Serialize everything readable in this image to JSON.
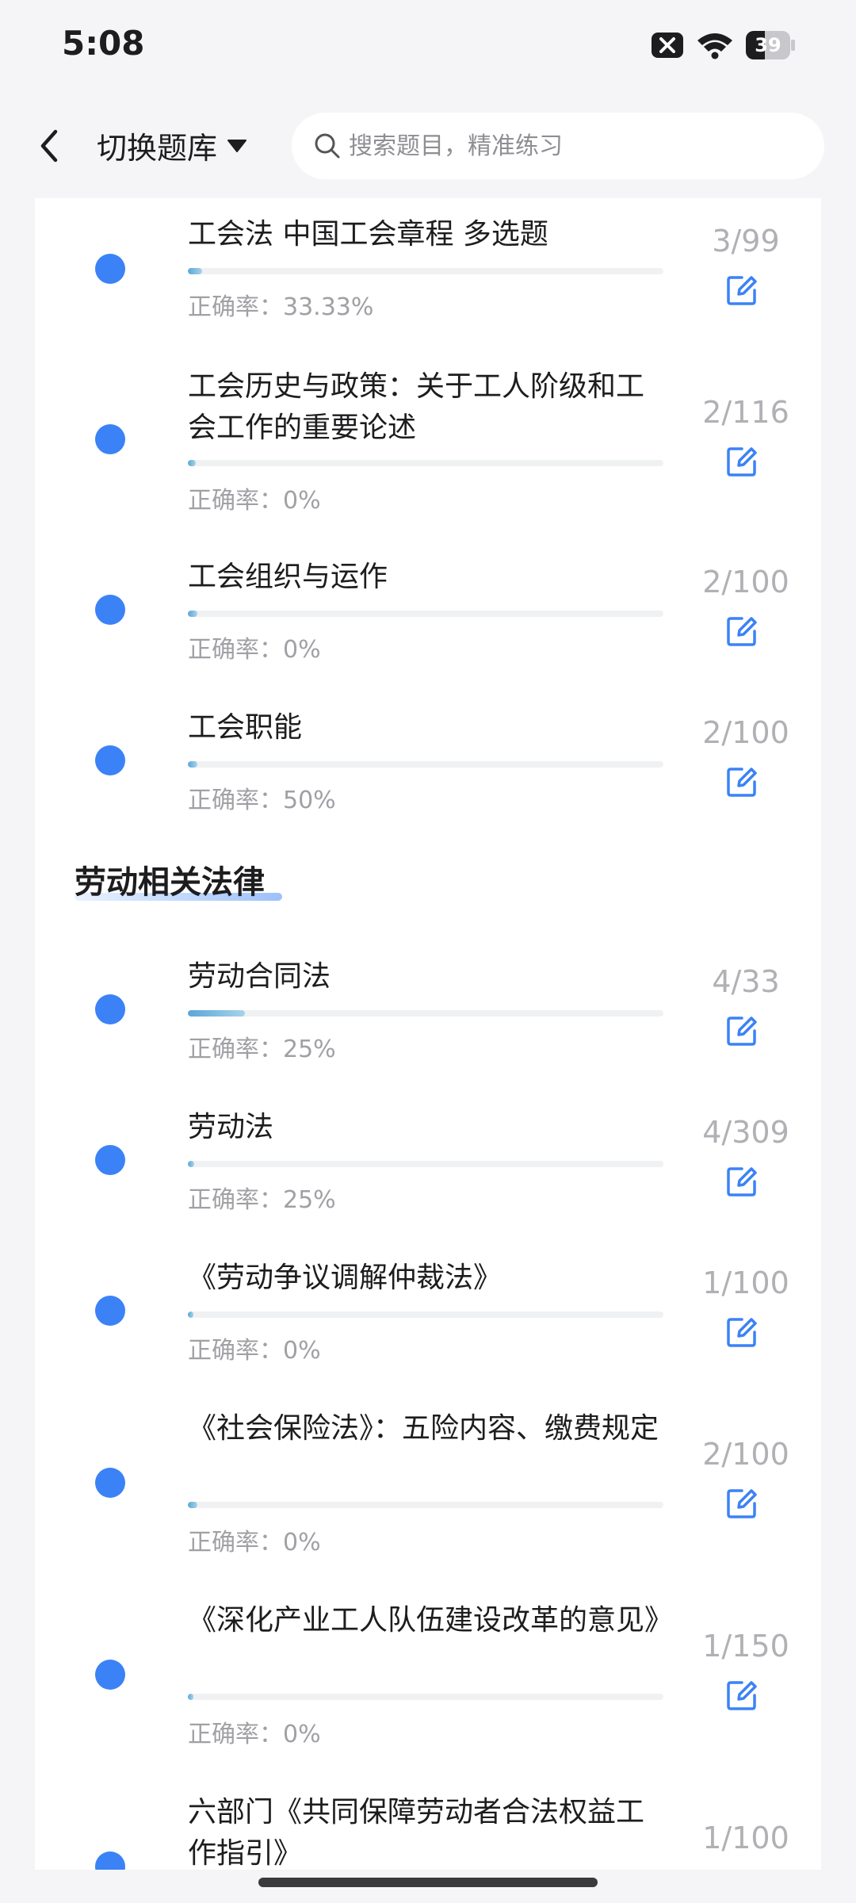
{
  "status_bar": {
    "time": "5:08",
    "battery_level": "39"
  },
  "header": {
    "bank_switch_label": "切换题库",
    "search_placeholder": "搜索题目，精准练习"
  },
  "colors": {
    "accent": "#3b82f6",
    "muted_text": "#a0a0a5",
    "count_text": "#b0b0b5"
  },
  "items_top": [
    {
      "title": "工会法 中国工会章程 多选题",
      "accuracy": "正确率：33.33%",
      "count": "3/99",
      "progress": 0.03
    },
    {
      "title": "工会历史与政策：关于工人阶级和工会工作的重要论述",
      "accuracy": "正确率：0%",
      "count": "2/116",
      "progress": 0.017
    },
    {
      "title": "工会组织与运作",
      "accuracy": "正确率：0%",
      "count": "2/100",
      "progress": 0.02
    },
    {
      "title": "工会职能",
      "accuracy": "正确率：50%",
      "count": "2/100",
      "progress": 0.02
    }
  ],
  "section": {
    "title": "劳动相关法律"
  },
  "items_labor": [
    {
      "title": "劳动合同法",
      "accuracy": "正确率：25%",
      "count": "4/33",
      "progress": 0.12
    },
    {
      "title": "劳动法",
      "accuracy": "正确率：25%",
      "count": "4/309",
      "progress": 0.013
    },
    {
      "title": "《劳动争议调解仲裁法》",
      "accuracy": "正确率：0%",
      "count": "1/100",
      "progress": 0.01
    },
    {
      "title": "《社会保险法》：五险内容、缴费规定",
      "accuracy": "正确率：0%",
      "count": "2/100",
      "progress": 0.02
    },
    {
      "title": "《深化产业工人队伍建设改革的意见》",
      "accuracy": "正确率：0%",
      "count": "1/150",
      "progress": 0.007
    },
    {
      "title": "六部门《共同保障劳动者合法权益工作指引》",
      "count": "1/100"
    }
  ]
}
